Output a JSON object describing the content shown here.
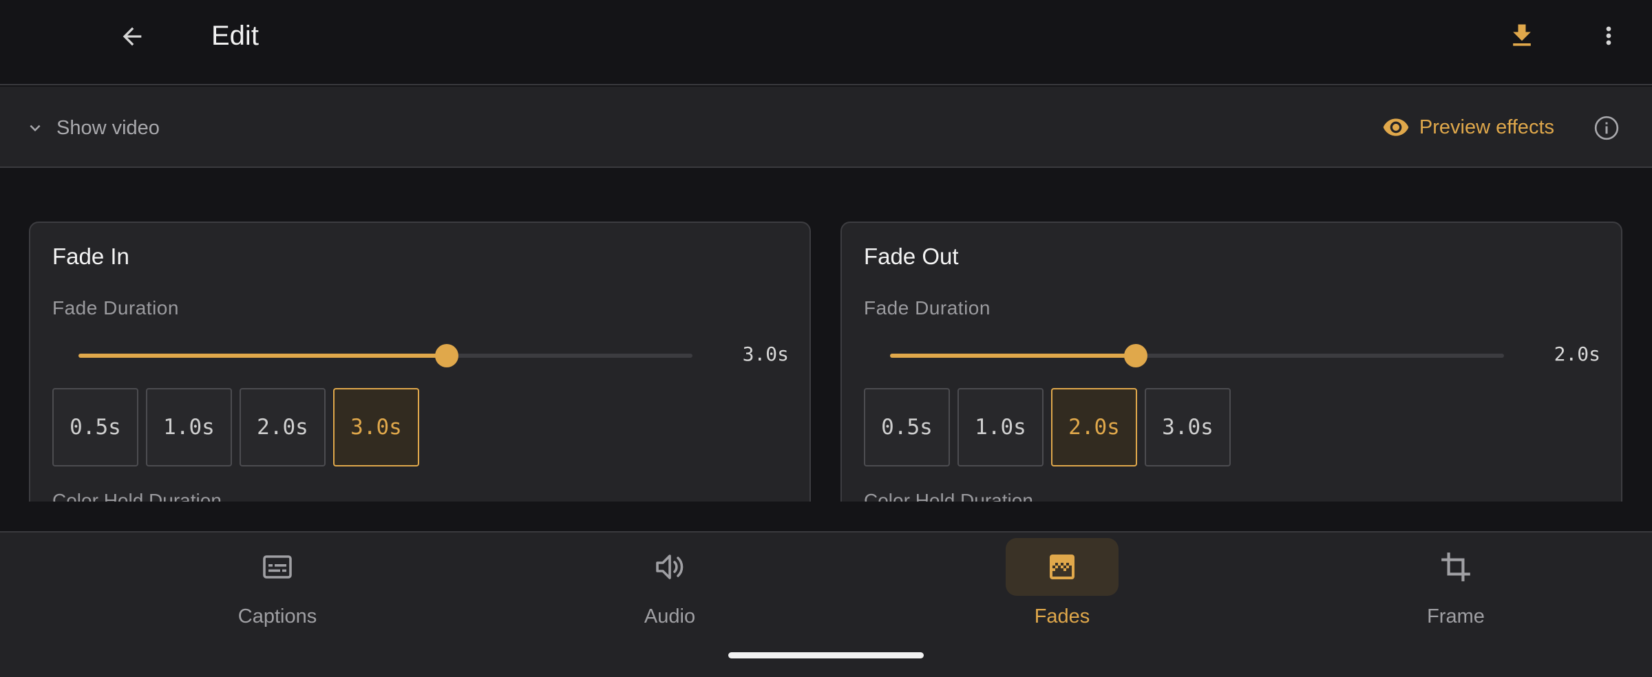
{
  "header": {
    "title": "Edit",
    "back_icon": "arrow-left-icon",
    "download_icon": "download-icon",
    "more_icon": "more-vert-icon"
  },
  "video_bar": {
    "show_video_label": "Show video",
    "preview_label": "Preview effects"
  },
  "fade_in": {
    "title": "Fade In",
    "duration_label": "Fade Duration",
    "value_text": "3.0s",
    "slider_fraction": 0.6,
    "presets": [
      "0.5s",
      "1.0s",
      "2.0s",
      "3.0s"
    ],
    "selected_index": 3,
    "next_label": "Color Hold Duration"
  },
  "fade_out": {
    "title": "Fade Out",
    "duration_label": "Fade Duration",
    "value_text": "2.0s",
    "slider_fraction": 0.4,
    "presets": [
      "0.5s",
      "1.0s",
      "2.0s",
      "3.0s"
    ],
    "selected_index": 2,
    "next_label": "Color Hold Duration"
  },
  "nav": {
    "items": [
      {
        "label": "Captions",
        "icon": "captions-icon"
      },
      {
        "label": "Audio",
        "icon": "volume-icon"
      },
      {
        "label": "Fades",
        "icon": "gradient-icon"
      },
      {
        "label": "Frame",
        "icon": "crop-icon"
      }
    ],
    "active_index": 2
  },
  "colors": {
    "accent": "#e0a84b",
    "background": "#141417",
    "surface": "#232326",
    "muted_text": "#a0a0a4"
  }
}
